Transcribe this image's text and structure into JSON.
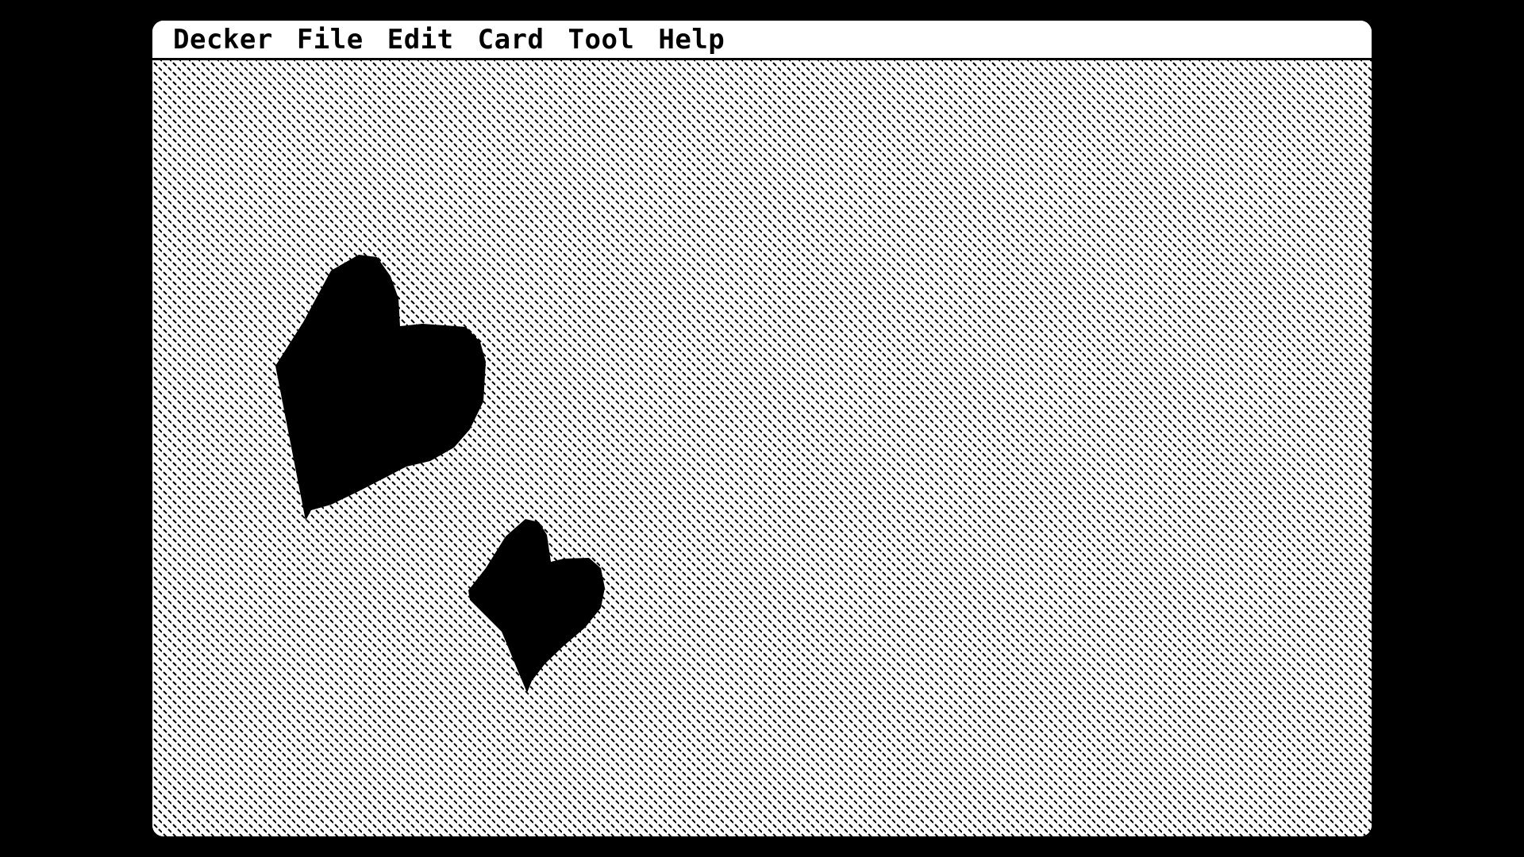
{
  "menubar": {
    "items": [
      {
        "label": "Decker"
      },
      {
        "label": "File"
      },
      {
        "label": "Edit"
      },
      {
        "label": "Card"
      },
      {
        "label": "Tool"
      },
      {
        "label": "Help"
      }
    ]
  },
  "card": {
    "background_pattern": "diagonal-dash",
    "background_color": "#ffffff",
    "ink_color": "#000000",
    "shapes": [
      {
        "kind": "heart-icon"
      },
      {
        "kind": "heart-icon"
      }
    ]
  }
}
